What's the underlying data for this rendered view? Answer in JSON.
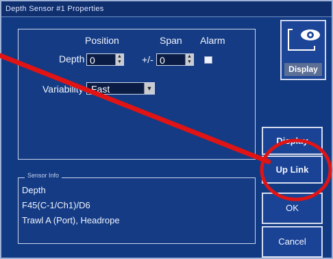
{
  "window": {
    "title": "Depth Sensor #1 Properties"
  },
  "columns": {
    "position": "Position",
    "span": "Span",
    "alarm": "Alarm"
  },
  "depth_row": {
    "label": "Depth",
    "position_value": "0",
    "plus_minus": "+/-",
    "span_value": "0"
  },
  "variability": {
    "label": "Variability",
    "value": "Fast"
  },
  "sensor_info": {
    "legend": "Sensor Info",
    "lines": [
      "Depth",
      "F45(C-1/Ch1)/D6",
      "Trawl A (Port), Headrope"
    ]
  },
  "display_tile": {
    "label": "Display",
    "icon": "eye-icon"
  },
  "buttons": {
    "display": "Display",
    "uplink": "Up Link",
    "ok": "OK",
    "cancel": "Cancel"
  },
  "annotation": {
    "color": "#e01414"
  }
}
